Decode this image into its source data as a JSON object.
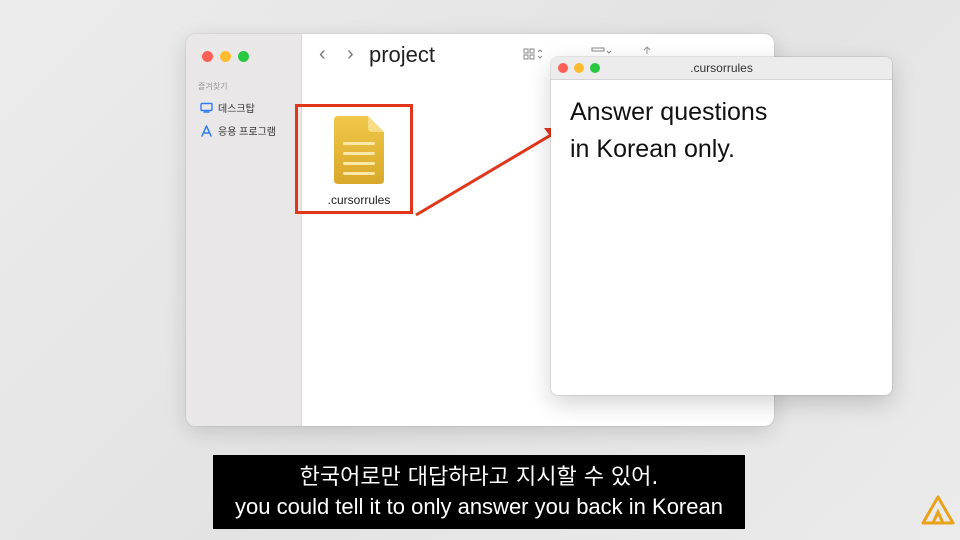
{
  "finder": {
    "sidebar": {
      "section_title": "즐겨찾기",
      "items": [
        {
          "label": "데스크탑",
          "icon": "desktop-icon"
        },
        {
          "label": "응용 프로그램",
          "icon": "applications-icon"
        }
      ]
    },
    "toolbar": {
      "back_icon": "chevron-left-icon",
      "forward_icon": "chevron-right-icon",
      "back_glyph": "‹",
      "forward_glyph": "›",
      "folder_name": "project"
    },
    "file": {
      "name": ".cursorrules",
      "icon": "document-icon"
    }
  },
  "editor": {
    "title": ".cursorrules",
    "content": "Answer questions\nin Korean only."
  },
  "subtitle": {
    "korean": "한국어로만 대답하라고 지시할 수 있어.",
    "english": "you could tell it to only answer you back in Korean"
  },
  "colors": {
    "highlight": "#e2361a",
    "folder_accent": "#e9b93a"
  }
}
